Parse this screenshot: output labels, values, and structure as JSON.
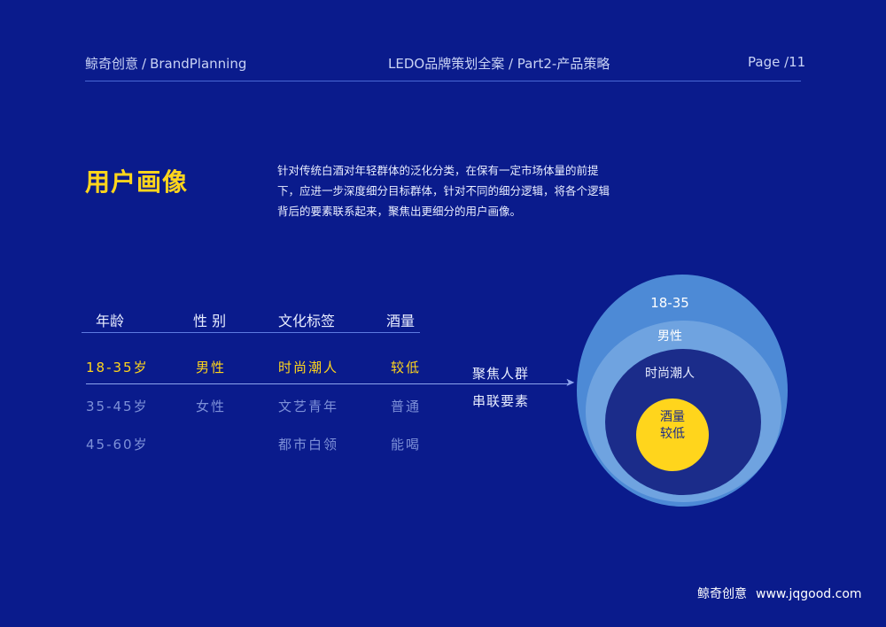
{
  "header": {
    "brand": "鲸奇创意",
    "separator": "/",
    "brand_en": "BrandPlanning",
    "center": "LEDO品牌策划全案 / Part2-产品策略",
    "page": "Page /11"
  },
  "section": {
    "title": "用户画像",
    "description": "针对传统白酒对年轻群体的泛化分类，在保有一定市场体量的前提下，应进一步深度细分目标群体，针对不同的细分逻辑，将各个逻辑背后的要素联系起来，聚焦出更细分的用户画像。"
  },
  "table": {
    "headers": [
      "年龄",
      "性 别",
      "文化标签",
      "酒量"
    ],
    "rows": [
      [
        "18-35岁",
        "男性",
        "时尚潮人",
        "较低"
      ],
      [
        "35-45岁",
        "女性",
        "文艺青年",
        "普通"
      ],
      [
        "45-60岁",
        "",
        "都市白领",
        "能喝"
      ]
    ]
  },
  "arrow": {
    "line1": "聚焦人群",
    "line2": "串联要素",
    "head": "➤"
  },
  "circles": {
    "outer": "18-35",
    "middle": "男性",
    "inner": "时尚潮人",
    "core_line1": "酒量",
    "core_line2": "较低"
  },
  "footer": {
    "brand": "鲸奇创意",
    "url": "www.jqgood.com"
  },
  "colors": {
    "background": "#0a1b8c",
    "accent": "#ffd51c",
    "outer_circle": "#4d8ad6",
    "middle_circle": "#6fa3e0",
    "inner_circle": "#1b2c8a"
  }
}
